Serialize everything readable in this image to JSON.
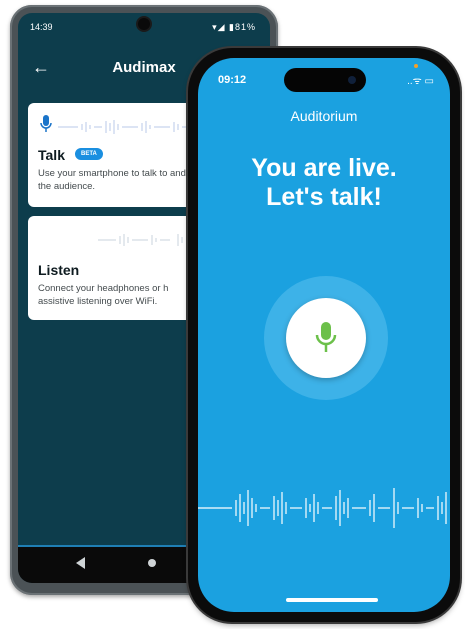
{
  "android": {
    "status": {
      "time": "14:39",
      "indicators": "▾◢ ▮81%"
    },
    "header": {
      "back_icon": "arrow-left-icon",
      "title": "Audimax"
    },
    "talk_card": {
      "icon": "microphone-icon",
      "title": "Talk",
      "badge": "BETA",
      "description": "Use your smartphone to talk to and the audience."
    },
    "listen_card": {
      "title": "Listen",
      "description": "Connect your headphones or h assistive listening over WiFi."
    },
    "nav": {
      "back_icon": "triangle-back-icon",
      "home_icon": "circle-home-icon"
    }
  },
  "iphone": {
    "status": {
      "time": "09:12",
      "indicators": "..ᯤ ▭"
    },
    "title": "Auditorium",
    "headline_line1": "You are live.",
    "headline_line2": "Let's talk!",
    "mic_icon": "microphone-icon",
    "colors": {
      "background": "#1ba1e0",
      "mic": "#6cc04a",
      "ring": "#3db2e8"
    }
  }
}
